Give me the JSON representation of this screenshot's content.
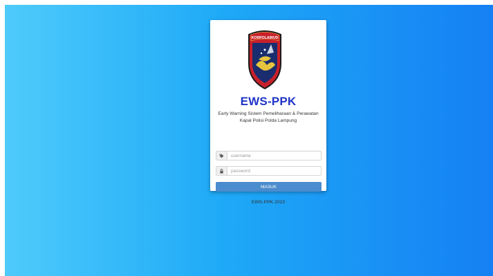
{
  "app": {
    "title": "EWS-PPK",
    "subtitle_line1": "Early Warning Sistem Pemeliharaan & Perawatan",
    "subtitle_line2": "Kapal Polisi Polda Lampung",
    "logo_text": "KORPOLAIRUD"
  },
  "form": {
    "username_placeholder": "username",
    "password_placeholder": "password",
    "submit_label": "MASUK",
    "username_icon": "tag-icon",
    "password_icon": "lock-icon"
  },
  "footer": {
    "text": "EWS-PPK 2023"
  },
  "colors": {
    "accent": "#4a8ccd",
    "title": "#2034c8",
    "background_start": "#4ecbfb",
    "background_end": "#1580f3"
  }
}
